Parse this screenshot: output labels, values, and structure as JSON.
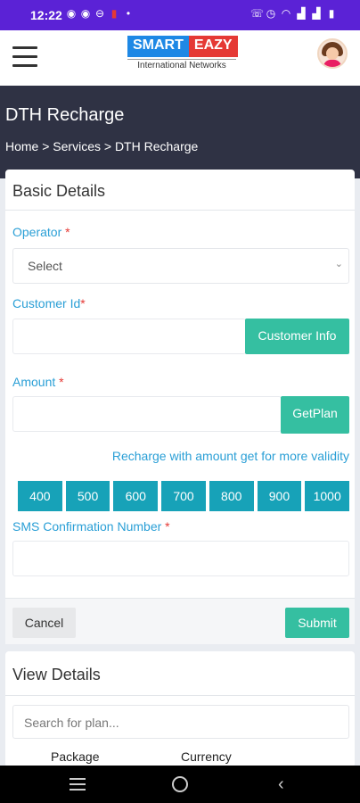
{
  "status_bar": {
    "time": "12:22",
    "left_icons": [
      "whatsapp-icon",
      "whatsapp-icon",
      "dnd-icon",
      "sim-icon",
      "dot-icon"
    ],
    "right_icons": [
      "volte-icon",
      "alarm-icon",
      "wifi-icon",
      "signal-icon",
      "signal-icon",
      "battery-icon"
    ]
  },
  "header": {
    "logo_left": "SMART",
    "logo_right": "EAZY",
    "logo_sub": "International Networks",
    "brand_colors": {
      "blue": "#1e88e5",
      "red": "#e53935"
    }
  },
  "banner": {
    "title": "DTH Recharge",
    "breadcrumb": "Home > Services > DTH Recharge"
  },
  "basic_details": {
    "title": "Basic Details",
    "operator_label": "Operator ",
    "operator_req": "*",
    "operator_select": "Select",
    "customer_id_label": "Customer Id",
    "customer_id_req": "*",
    "customer_info_button": "Customer Info",
    "amount_label": "Amount ",
    "amount_req": "*",
    "getplan_button": "GetPlan",
    "validity_link": "Recharge with amount get for more validity",
    "amounts": [
      "400",
      "500",
      "600",
      "700",
      "800",
      "900",
      "1000"
    ],
    "sms_label": "SMS Confirmation Number ",
    "sms_req": "*",
    "cancel_button": "Cancel",
    "submit_button": "Submit"
  },
  "view_details": {
    "title": "View Details",
    "search_placeholder": "Search for plan...",
    "columns": [
      "Package",
      "Currency"
    ]
  },
  "colors": {
    "status_bar": "#5b22d6",
    "banner": "#2f3244",
    "accent_teal": "#35bfa1",
    "amount_chip": "#17a2b8",
    "label_blue": "#2a9fd6"
  }
}
